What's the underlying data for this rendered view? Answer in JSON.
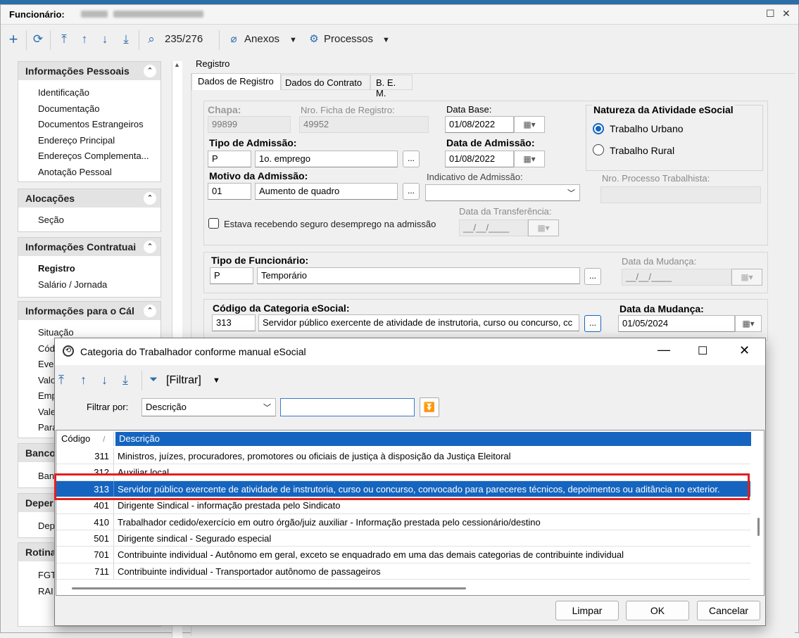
{
  "main": {
    "title_prefix": "Funcionário:",
    "toolbar": {
      "record_counter": "235/276",
      "anexos": "Anexos",
      "processos": "Processos"
    }
  },
  "sidebar": {
    "groups": [
      {
        "title": "Informações Pessoais",
        "items": [
          "Identificação",
          "Documentação",
          "Documentos Estrangeiros",
          "Endereço Principal",
          "Endereços Complementa...",
          "Anotação Pessoal"
        ]
      },
      {
        "title": "Alocações",
        "items": [
          "Seção"
        ]
      },
      {
        "title": "Informações Contratuai",
        "items": [
          "Registro",
          "Salário / Jornada"
        ]
      },
      {
        "title": "Informações para o Cál",
        "items": [
          "Situação",
          "Cód",
          "Eve",
          "Valo",
          "Emp",
          "Vale",
          "Para"
        ]
      },
      {
        "title": "Banco",
        "items": [
          "Ban"
        ]
      },
      {
        "title": "Deper",
        "items": [
          "Dep"
        ]
      },
      {
        "title": "Rotina",
        "items": [
          "FGT",
          "RAI"
        ]
      }
    ]
  },
  "registro": {
    "section_label": "Registro",
    "tabs": [
      "Dados de Registro",
      "Dados do Contrato",
      "B. E. M."
    ],
    "chapa_label": "Chapa:",
    "chapa": "99899",
    "ficha_label": "Nro. Ficha de Registro:",
    "ficha": "49952",
    "data_base_label": "Data Base:",
    "data_base": "01/08/2022",
    "tipo_admissao_label": "Tipo de Admissão:",
    "tipo_admissao_code": "P",
    "tipo_admissao_desc": "1o. emprego",
    "data_admissao_label": "Data de Admissão:",
    "data_admissao": "01/08/2022",
    "motivo_label": "Motivo da Admissão:",
    "motivo_code": "01",
    "motivo_desc": "Aumento de quadro",
    "indicativo_label": "Indicativo de Admissão:",
    "nro_processo_label": "Nro. Processo Trabalhista:",
    "natureza_title": "Natureza da Atividade eSocial",
    "natureza_opt1": "Trabalho Urbano",
    "natureza_opt2": "Trabalho Rural",
    "seguro_label": "Estava recebendo seguro desemprego na admissão",
    "data_transf_label": "Data da Transferência:",
    "empty_date": "__/__/____",
    "tipo_func_label": "Tipo de Funcionário:",
    "tipo_func_code": "P",
    "tipo_func_desc": "Temporário",
    "data_mudanca_label": "Data da Mudança:",
    "categoria_label": "Código da Categoria eSocial:",
    "categoria_code": "313",
    "categoria_desc": "Servidor público exercente de atividade de instrutoria, curso ou concurso, cc",
    "data_mudanca2_label": "Data da Mudança:",
    "data_mudanca2": "01/05/2024",
    "ellipsis": "..."
  },
  "dialog": {
    "title": "Categoria do Trabalhador conforme manual eSocial",
    "filter_button": "[Filtrar]",
    "filter_by_label": "Filtrar por:",
    "filter_field": "Descrição",
    "filter_value": "",
    "col_code": "Código",
    "col_desc": "Descrição",
    "rows": [
      {
        "code": "311",
        "desc": "Ministros, juízes, procuradores, promotores ou oficiais de justiça à disposição da Justiça Eleitoral"
      },
      {
        "code": "312",
        "desc": "Auxiliar local"
      },
      {
        "code": "313",
        "desc": "Servidor público exercente de atividade de instrutoria, curso ou concurso, convocado para pareceres técnicos, depoimentos ou aditância no exterior."
      },
      {
        "code": "401",
        "desc": "Dirigente Sindical - informação prestada pelo Sindicato"
      },
      {
        "code": "410",
        "desc": "Trabalhador cedido/exercício em outro órgão/juiz auxiliar - Informação prestada pelo cessionário/destino"
      },
      {
        "code": "501",
        "desc": "Dirigente sindical - Segurado especial"
      },
      {
        "code": "701",
        "desc": "Contribuinte individual - Autônomo em geral, exceto se enquadrado em uma das demais categorias de contribuinte individual"
      },
      {
        "code": "711",
        "desc": "Contribuinte individual - Transportador autônomo de passageiros"
      }
    ],
    "selected_index": 2,
    "btn_limpar": "Limpar",
    "btn_ok": "OK",
    "btn_cancelar": "Cancelar"
  },
  "colors": {
    "accent": "#1565c0",
    "highlight": "#e02020",
    "toolbar_icon": "#2b6cb0"
  }
}
